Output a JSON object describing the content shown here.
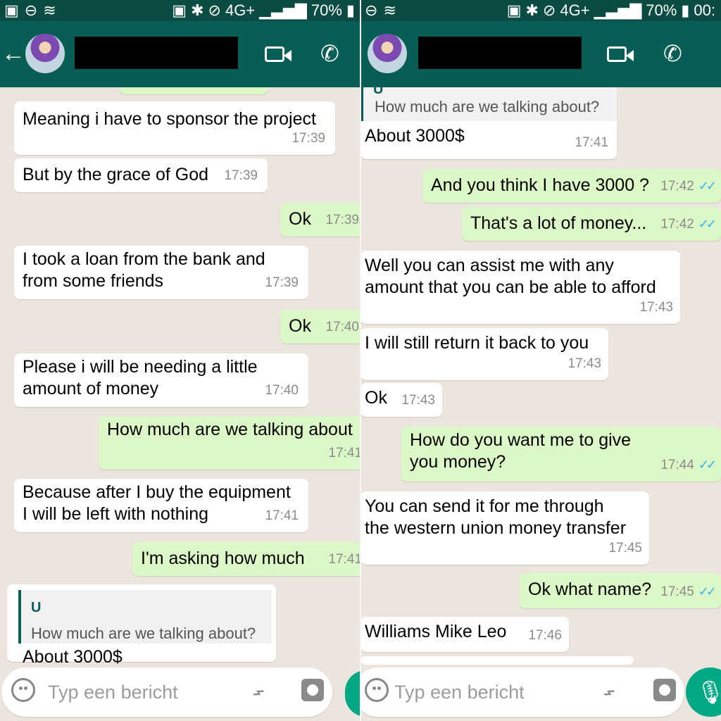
{
  "status": {
    "network": "4G+",
    "battery": "70%",
    "time_partial": "00:"
  },
  "left": {
    "messages": [
      {
        "dir": "in",
        "text": "Meaning i have to sponsor the project",
        "time": "17:39"
      },
      {
        "dir": "in",
        "text": "But by the grace of God",
        "time": "17:39"
      },
      {
        "dir": "out",
        "text": "Ok",
        "time": "17:39"
      },
      {
        "dir": "in",
        "text": "I took a loan from the bank and\nfrom some friends",
        "time": "17:39"
      },
      {
        "dir": "out",
        "text": "Ok",
        "time": "17:40"
      },
      {
        "dir": "in",
        "text": "Please i will be needing a little\namount of money",
        "time": "17:40"
      },
      {
        "dir": "out",
        "text": "How much are we talking about",
        "time": "17:41"
      },
      {
        "dir": "in",
        "text": "Because after I buy the equipment\nI will be left with nothing",
        "time": "17:41"
      },
      {
        "dir": "out",
        "text": "I'm asking how much",
        "time": "17:41"
      }
    ],
    "quoted": {
      "author": "U",
      "text": "How much are we talking about?",
      "reply": "About 3000$"
    },
    "input_placeholder": "Typ een bericht"
  },
  "right": {
    "quoted": {
      "author": "U",
      "text": "How much are we talking about?",
      "reply": "About 3000$",
      "time": "17:41"
    },
    "messages": [
      {
        "dir": "out",
        "text": "And you think I have 3000 ?",
        "time": "17:42",
        "read": true
      },
      {
        "dir": "out",
        "text": "That's a lot of money...",
        "time": "17:42",
        "read": true
      },
      {
        "dir": "in",
        "text": "Well you can assist me with any\namount that you can be able to afford",
        "time": "17:43"
      },
      {
        "dir": "in",
        "text": "I will still return it back to you",
        "time": "17:43"
      },
      {
        "dir": "in",
        "text": "Ok",
        "time": "17:43"
      },
      {
        "dir": "out",
        "text": "How do you want me to give\nyou money?",
        "time": "17:44",
        "read": true
      },
      {
        "dir": "in",
        "text": "You can send it for me through\nthe western union money transfer",
        "time": "17:45"
      },
      {
        "dir": "out",
        "text": "Ok what name?",
        "time": "17:45",
        "read": true
      },
      {
        "dir": "in",
        "text": "Williams Mike Leo",
        "time": "17:46"
      }
    ],
    "input_placeholder": "Typ een bericht"
  },
  "colors": {
    "header": "#075e54",
    "status": "#0a4b43",
    "incoming": "#ffffff",
    "outgoing": "#dcf8c6",
    "read_ticks": "#34b7f1"
  },
  "icons": [
    "back-arrow-icon",
    "video-call-icon",
    "phone-icon",
    "more-options-icon",
    "emoji-icon",
    "attach-icon",
    "camera-icon",
    "mic-icon",
    "scroll-down-icon"
  ]
}
